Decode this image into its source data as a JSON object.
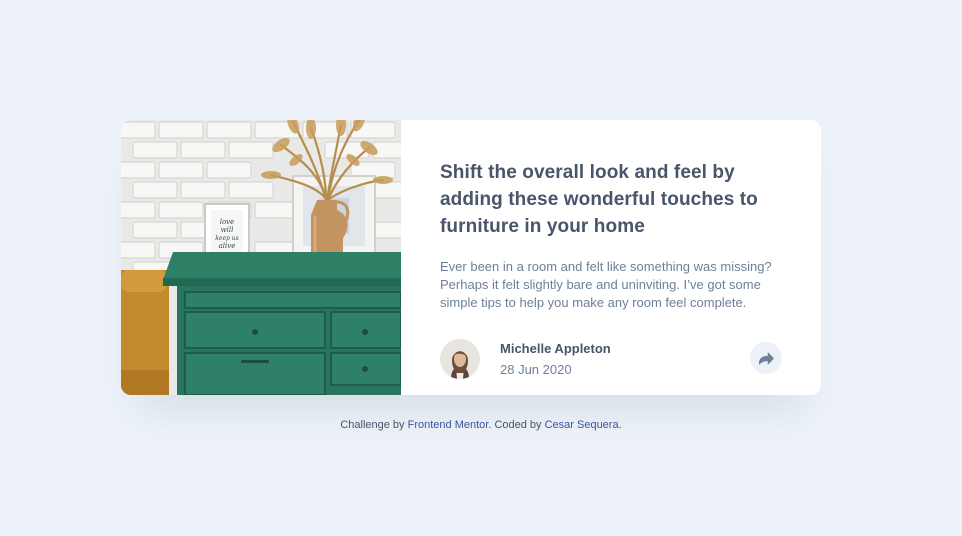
{
  "article": {
    "image_alt": "Green drawer with vase and picture frames",
    "title": "Shift the overall look and feel by adding these wonderful touches to furniture in your home",
    "description": "Ever been in a room and felt like something was missing? Perhaps it felt slightly bare and uninviting. I’ve got some simple tips to help you make any room feel complete.",
    "author": {
      "name": "Michelle Appleton",
      "date": "28 Jun 2020"
    },
    "share_icon": "share-icon"
  },
  "attribution": {
    "prefix": "Challenge by",
    "challenge_link": "Frontend Mentor",
    "middle": ". Coded by",
    "author_link": "Cesar Sequera",
    "suffix": "."
  },
  "colors": {
    "background": "#ECF2F8",
    "title": "#48556A",
    "text": "#6E8098",
    "link": "#3e52a3",
    "drawer": "#2A7A63"
  }
}
